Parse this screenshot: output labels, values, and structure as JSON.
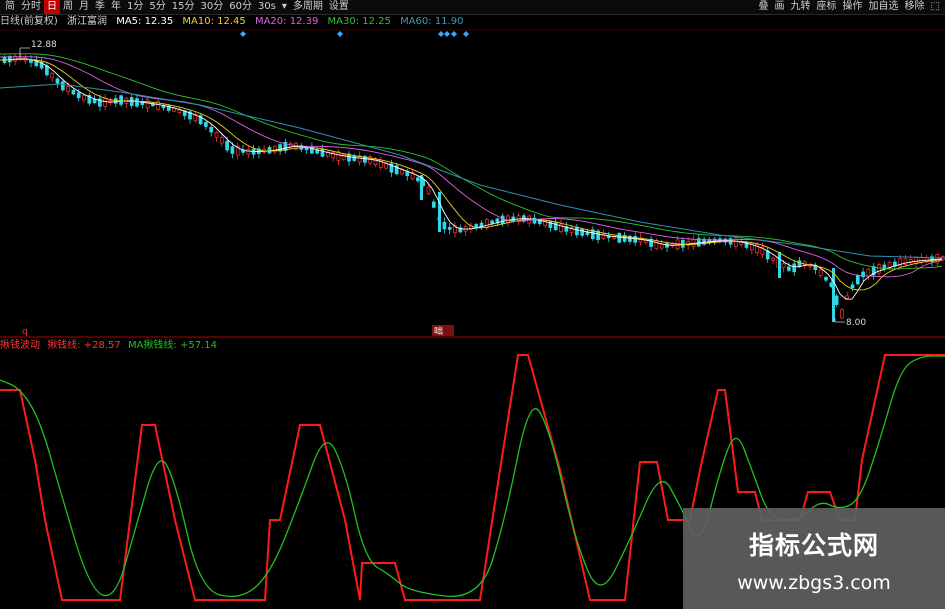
{
  "toolbar": {
    "left_items": [
      "简",
      "分时",
      "日",
      "周",
      "月",
      "季",
      "年",
      "1分",
      "5分",
      "15分",
      "30分",
      "60分",
      "30s",
      "▾",
      "多周期",
      "设置"
    ],
    "active_index": 2,
    "right_items": [
      "叠",
      "画",
      "九转",
      "座标",
      "操作",
      "加自选",
      "移除",
      "⬚"
    ]
  },
  "main_header": {
    "label": "日线(前复权)",
    "stock_name": "浙江富润",
    "ma5": "MA5: 12.35",
    "ma10": "MA10: 12.45",
    "ma20": "MA20: 12.39",
    "ma30": "MA30: 12.25",
    "ma60": "MA60: 11.90"
  },
  "colors": {
    "up": "#ff3333",
    "down": "#33d6e6",
    "ma5": "#ffffff",
    "ma10": "#f0d020",
    "ma20": "#e060e0",
    "ma30": "#30c030",
    "ma60": "#3090b0",
    "osc_main": "#ff1a1a",
    "osc_signal": "#22c022",
    "grid": "#5a0000",
    "diamond": "#33aaff"
  },
  "annotations": {
    "high_price": "12.88",
    "low_price": "8.00",
    "marker_q": "q",
    "marker_box": "咄"
  },
  "sub_header": {
    "title": "揪钱波动",
    "value1": "揪钱线: +28.57",
    "value2": "MA揪钱线: +57.14"
  },
  "watermark": {
    "title": "指标公式网",
    "url": "www.zbgs3.com"
  }
}
